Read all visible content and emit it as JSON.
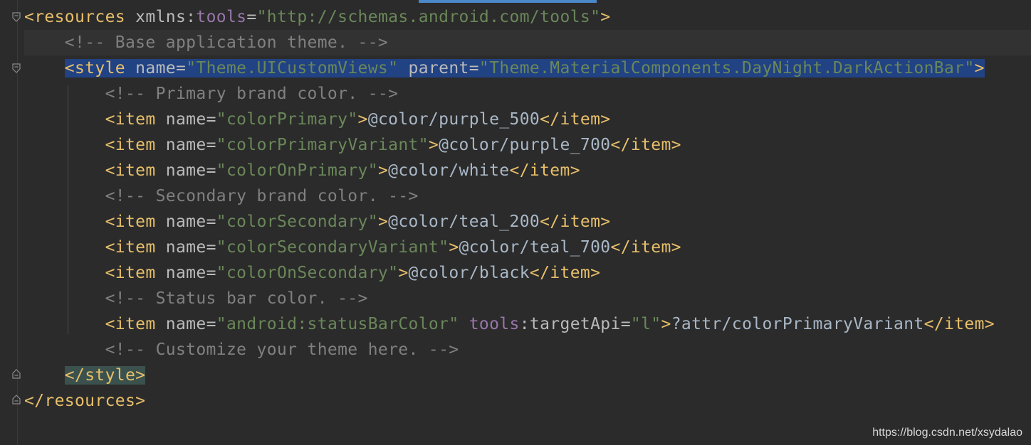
{
  "watermark": "https://blog.csdn.net/xsydalao",
  "colors": {
    "background": "#2b2b2b",
    "tag": "#e8bf6a",
    "attribute": "#bababa",
    "value": "#6a8759",
    "namespace": "#9876aa",
    "text": "#a9b7c6",
    "comment": "#808080",
    "selection": "#214283",
    "brace_match": "#3b514d"
  },
  "code": {
    "l1": {
      "open": "<resources",
      "attr": " xmlns",
      "colon": ":",
      "ns": "tools",
      "eq": "=",
      "val": "\"http://schemas.android.com/tools\"",
      "close": ">"
    },
    "l2": {
      "comment": "<!-- Base application theme. -->"
    },
    "l3": {
      "open": "<style",
      "attr1": " name",
      "eq1": "=",
      "val1": "\"Theme.UICustomViews\"",
      "attr2": " parent",
      "eq2": "=",
      "val2": "\"Theme.MaterialComponents.DayNight.DarkActionBar\"",
      "close": ">"
    },
    "l4": {
      "comment": "<!-- Primary brand color. -->"
    },
    "l5": {
      "open": "<item",
      "attr": " name",
      "eq": "=",
      "val": "\"colorPrimary\"",
      "gt": ">",
      "text": "@color/purple_500",
      "end": "</item>"
    },
    "l6": {
      "open": "<item",
      "attr": " name",
      "eq": "=",
      "val": "\"colorPrimaryVariant\"",
      "gt": ">",
      "text": "@color/purple_700",
      "end": "</item>"
    },
    "l7": {
      "open": "<item",
      "attr": " name",
      "eq": "=",
      "val": "\"colorOnPrimary\"",
      "gt": ">",
      "text": "@color/white",
      "end": "</item>"
    },
    "l8": {
      "comment": "<!-- Secondary brand color. -->"
    },
    "l9": {
      "open": "<item",
      "attr": " name",
      "eq": "=",
      "val": "\"colorSecondary\"",
      "gt": ">",
      "text": "@color/teal_200",
      "end": "</item>"
    },
    "l10": {
      "open": "<item",
      "attr": " name",
      "eq": "=",
      "val": "\"colorSecondaryVariant\"",
      "gt": ">",
      "text": "@color/teal_700",
      "end": "</item>"
    },
    "l11": {
      "open": "<item",
      "attr": " name",
      "eq": "=",
      "val": "\"colorOnSecondary\"",
      "gt": ">",
      "text": "@color/black",
      "end": "</item>"
    },
    "l12": {
      "comment": "<!-- Status bar color. -->"
    },
    "l13": {
      "open": "<item",
      "attr": " name",
      "eq": "=",
      "val": "\"android:statusBarColor\"",
      "ns": " tools",
      "colon": ":",
      "attr2": "targetApi",
      "eq2": "=",
      "val2": "\"l\"",
      "gt": ">",
      "text": "?attr/colorPrimaryVariant",
      "end": "</item>"
    },
    "l14": {
      "comment": "<!-- Customize your theme here. -->"
    },
    "l15": {
      "close": "</style>"
    },
    "l16": {
      "close": "</resources>"
    }
  }
}
